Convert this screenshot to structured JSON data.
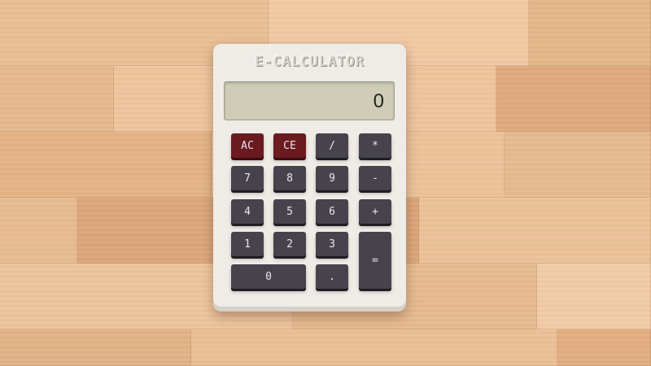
{
  "calculator": {
    "brand": "E-CALCULATOR",
    "display_value": "0",
    "keys": {
      "ac": "AC",
      "ce": "CE",
      "divide": "/",
      "multiply": "*",
      "seven": "7",
      "eight": "8",
      "nine": "9",
      "minus": "-",
      "four": "4",
      "five": "5",
      "six": "6",
      "plus": "+",
      "one": "1",
      "two": "2",
      "three": "3",
      "equals": "=",
      "zero": "0",
      "decimal": "."
    }
  },
  "colors": {
    "body": "#efece7",
    "key": "#47434d",
    "clear_key": "#6b1a1f",
    "display": "#cfcdb7",
    "background_wood": "#e8b98f"
  }
}
